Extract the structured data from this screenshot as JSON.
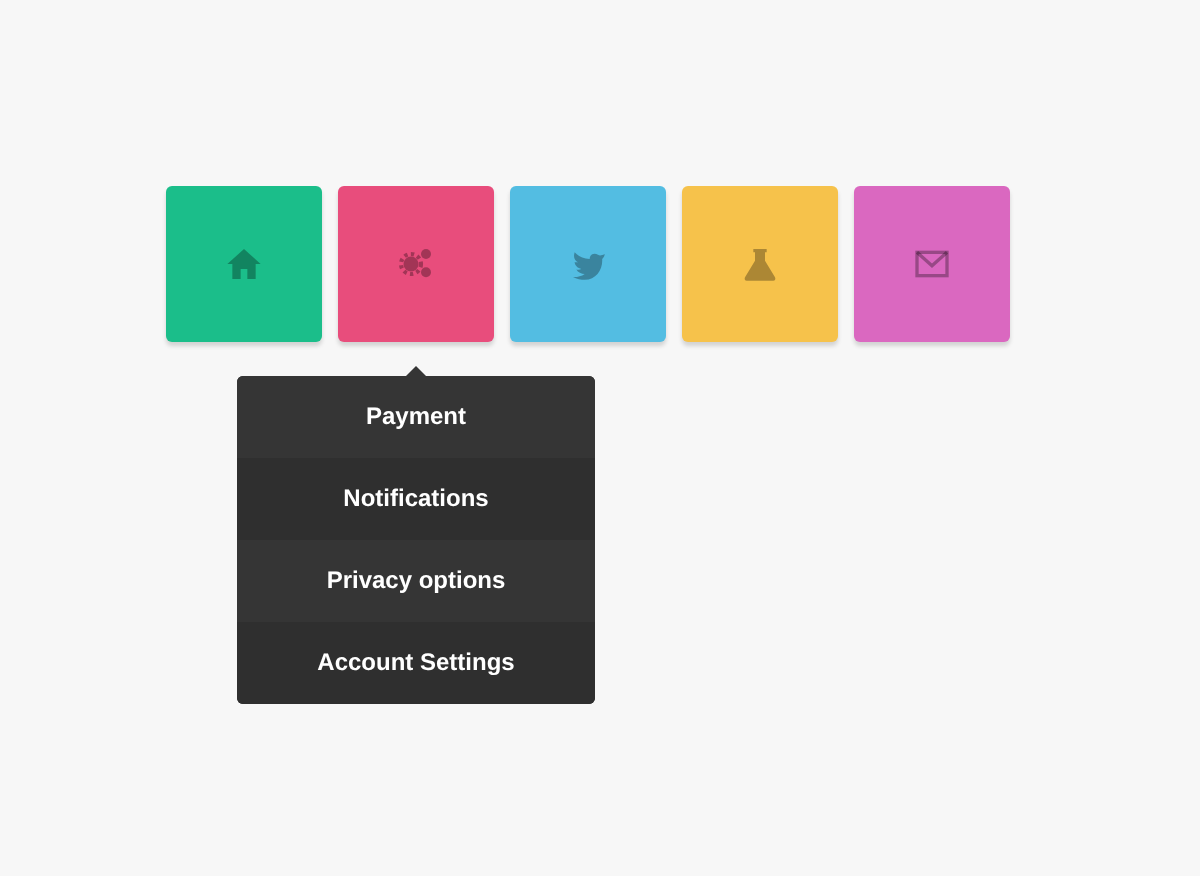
{
  "tiles": [
    {
      "kind": "home",
      "color": "#1bbe8a"
    },
    {
      "kind": "gears",
      "color": "#e84d7c",
      "menu": {
        "items": [
          "Payment",
          "Notifications",
          "Privacy options",
          "Account Settings"
        ]
      }
    },
    {
      "kind": "bird",
      "color": "#53bde2"
    },
    {
      "kind": "flask",
      "color": "#f6c24b"
    },
    {
      "kind": "mail",
      "color": "#da68c0"
    }
  ]
}
